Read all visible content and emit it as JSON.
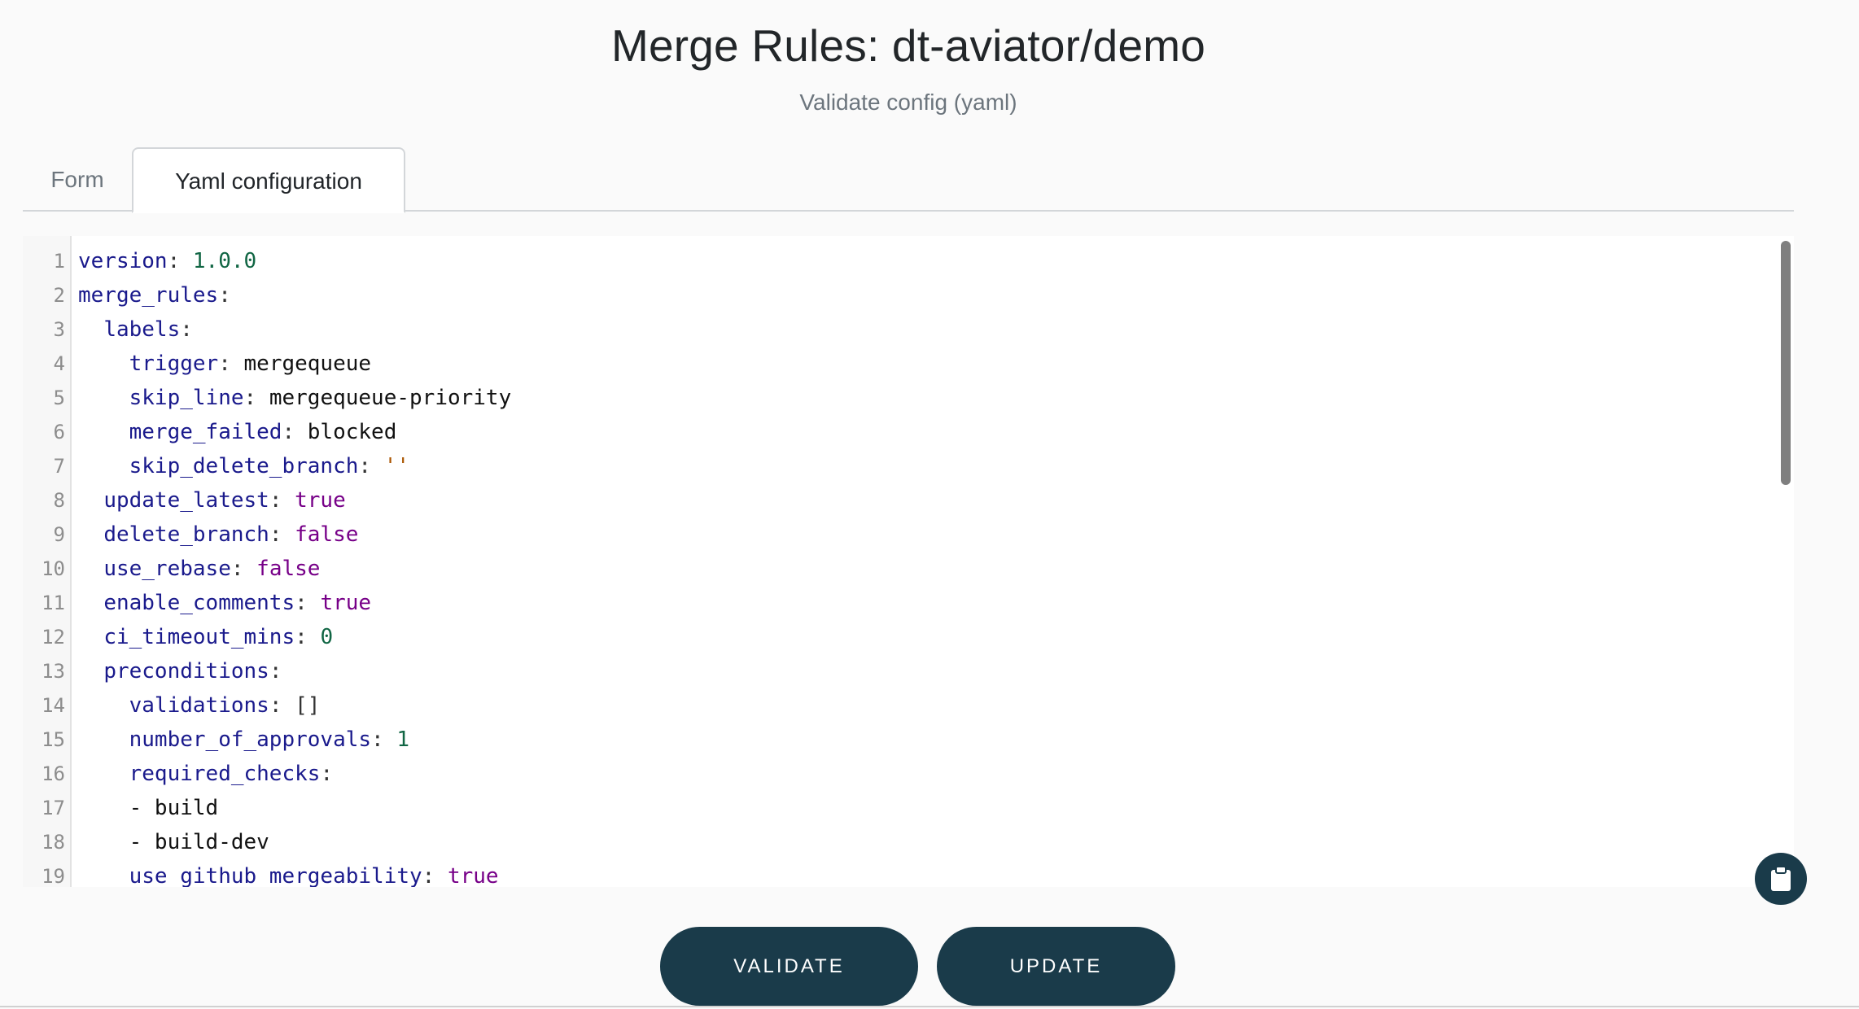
{
  "page": {
    "title": "Merge Rules: dt-aviator/demo",
    "subtitle": "Validate config (yaml)"
  },
  "tabs": [
    {
      "label": "Form",
      "active": false
    },
    {
      "label": "Yaml configuration",
      "active": true
    }
  ],
  "editor": {
    "lines": [
      {
        "n": "1",
        "indent": "",
        "key": "version",
        "value": "1.0.0",
        "type": "num"
      },
      {
        "n": "2",
        "indent": "",
        "key": "merge_rules",
        "value": "",
        "type": "none"
      },
      {
        "n": "3",
        "indent": "  ",
        "key": "labels",
        "value": "",
        "type": "none"
      },
      {
        "n": "4",
        "indent": "    ",
        "key": "trigger",
        "value": "mergequeue",
        "type": "plain"
      },
      {
        "n": "5",
        "indent": "    ",
        "key": "skip_line",
        "value": "mergequeue-priority",
        "type": "plain"
      },
      {
        "n": "6",
        "indent": "    ",
        "key": "merge_failed",
        "value": "blocked",
        "type": "plain"
      },
      {
        "n": "7",
        "indent": "    ",
        "key": "skip_delete_branch",
        "value": "''",
        "type": "str"
      },
      {
        "n": "8",
        "indent": "  ",
        "key": "update_latest",
        "value": "true",
        "type": "bool"
      },
      {
        "n": "9",
        "indent": "  ",
        "key": "delete_branch",
        "value": "false",
        "type": "bool"
      },
      {
        "n": "10",
        "indent": "  ",
        "key": "use_rebase",
        "value": "false",
        "type": "bool"
      },
      {
        "n": "11",
        "indent": "  ",
        "key": "enable_comments",
        "value": "true",
        "type": "bool"
      },
      {
        "n": "12",
        "indent": "  ",
        "key": "ci_timeout_mins",
        "value": "0",
        "type": "num"
      },
      {
        "n": "13",
        "indent": "  ",
        "key": "preconditions",
        "value": "",
        "type": "none"
      },
      {
        "n": "14",
        "indent": "    ",
        "key": "validations",
        "value": "[]",
        "type": "p"
      },
      {
        "n": "15",
        "indent": "    ",
        "key": "number_of_approvals",
        "value": "1",
        "type": "num"
      },
      {
        "n": "16",
        "indent": "    ",
        "key": "required_checks",
        "value": "",
        "type": "none"
      },
      {
        "n": "17",
        "indent": "    ",
        "key": "",
        "value": "- build",
        "type": "plain"
      },
      {
        "n": "18",
        "indent": "    ",
        "key": "",
        "value": "- build-dev",
        "type": "plain"
      },
      {
        "n": "19",
        "indent": "    ",
        "key": "use_github_mergeability",
        "value": "true",
        "type": "bool"
      }
    ]
  },
  "icons": {
    "copy_button": "clipboard-icon"
  },
  "actions": {
    "validate_label": "VALIDATE",
    "update_label": "UPDATE"
  },
  "colors": {
    "primary": "#1a3b4a",
    "yaml_key": "#1a1a8c",
    "yaml_number": "#116644",
    "yaml_boolean": "#770088",
    "yaml_string": "#aa5500"
  }
}
